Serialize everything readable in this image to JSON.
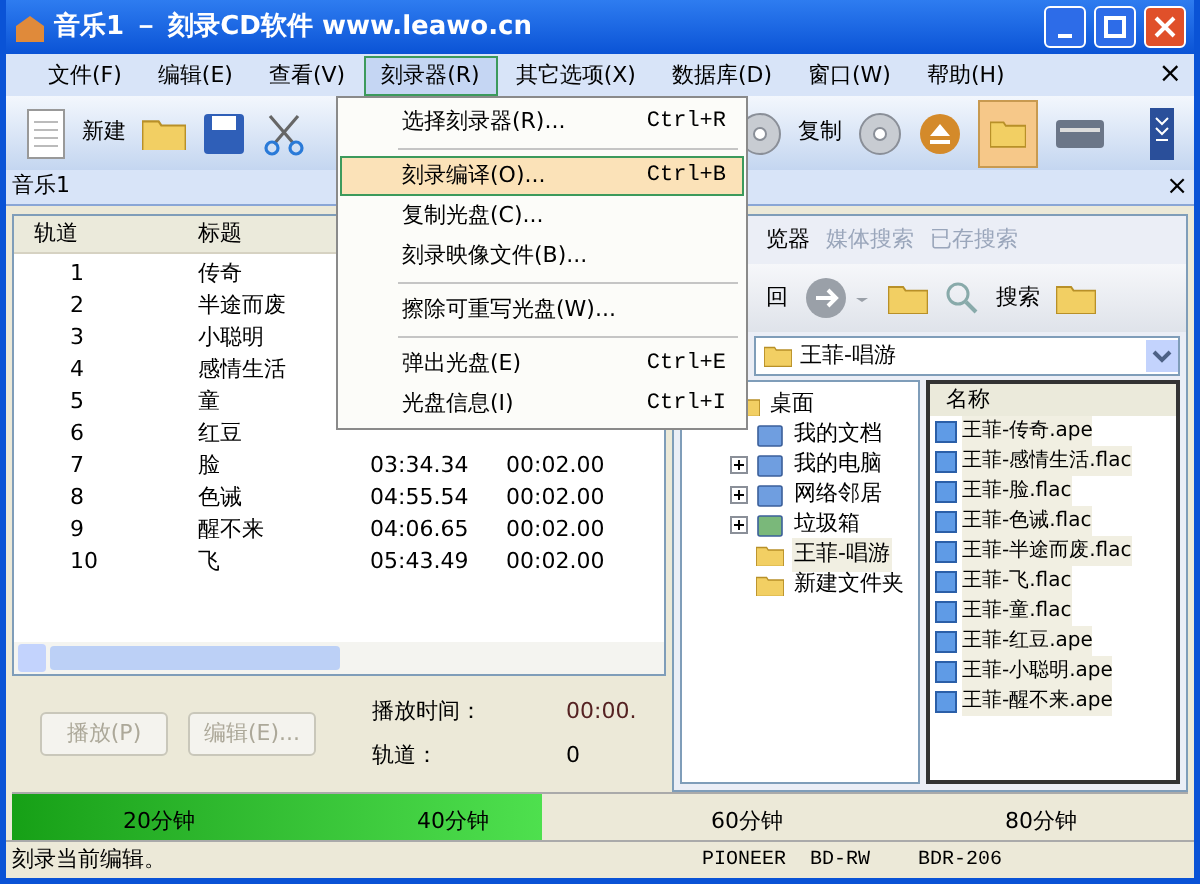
{
  "window": {
    "title": "音乐1 － 刻录CD软件 www.leawo.cn"
  },
  "menu_bar": [
    {
      "label": "文件(F)",
      "selected": false
    },
    {
      "label": "编辑(E)",
      "selected": false
    },
    {
      "label": "查看(V)",
      "selected": false
    },
    {
      "label": "刻录器(R)",
      "selected": true
    },
    {
      "label": "其它选项(X)",
      "selected": false
    },
    {
      "label": "数据库(D)",
      "selected": false
    },
    {
      "label": "窗口(W)",
      "selected": false
    },
    {
      "label": "帮助(H)",
      "selected": false
    }
  ],
  "menu_close": "×",
  "toolbar": {
    "new_label": "新建",
    "copy_label": "复制"
  },
  "dropdown": [
    {
      "kind": "item",
      "label": "选择刻录器(R)...",
      "shortcut": "Ctrl+R",
      "selected": false
    },
    {
      "kind": "separator"
    },
    {
      "kind": "item",
      "label": "刻录编译(O)...",
      "shortcut": "Ctrl+B",
      "selected": true
    },
    {
      "kind": "item",
      "label": "复制光盘(C)...",
      "selected": false
    },
    {
      "kind": "item",
      "label": "刻录映像文件(B)...",
      "selected": false
    },
    {
      "kind": "separator"
    },
    {
      "kind": "item",
      "label": "擦除可重写光盘(W)...",
      "selected": false
    },
    {
      "kind": "separator"
    },
    {
      "kind": "item",
      "label": "弹出光盘(E)",
      "shortcut": "Ctrl+E",
      "selected": false
    },
    {
      "kind": "item",
      "label": "光盘信息(I)",
      "shortcut": "Ctrl+I",
      "selected": false
    }
  ],
  "document": {
    "title": "音乐1",
    "close": "×"
  },
  "track_table": {
    "columns": [
      "轨道",
      "标题"
    ],
    "rows": [
      {
        "track": "1",
        "title": "传奇"
      },
      {
        "track": "2",
        "title": "半途而废"
      },
      {
        "track": "3",
        "title": "小聪明"
      },
      {
        "track": "4",
        "title": "感情生活"
      },
      {
        "track": "5",
        "title": "童"
      },
      {
        "track": "6",
        "title": "红豆"
      },
      {
        "track": "7",
        "title": "脸",
        "length": "03:34.34",
        "pause": "00:02.00"
      },
      {
        "track": "8",
        "title": "色诫",
        "length": "04:55.54",
        "pause": "00:02.00"
      },
      {
        "track": "9",
        "title": "醒不来",
        "length": "04:06.65",
        "pause": "00:02.00"
      },
      {
        "track": "10",
        "title": "飞",
        "length": "05:43.49",
        "pause": "00:02.00"
      }
    ]
  },
  "buttons": [
    {
      "label": "播放(P)",
      "disabled": true
    },
    {
      "label": "编辑(E)...",
      "disabled": true
    }
  ],
  "info": [
    {
      "label": "播放时间：",
      "value": "00:00."
    },
    {
      "label": "轨道：",
      "value": "0"
    }
  ],
  "browser": {
    "tabs": [
      {
        "label": "览器",
        "selected": true
      },
      {
        "label": "媒体搜索",
        "selected": false
      },
      {
        "label": "已存搜索",
        "selected": false
      }
    ],
    "back_label": "回",
    "search_label": "搜索",
    "address": "王菲-唱游",
    "tree": [
      {
        "label": "桌面",
        "children": [
          {
            "label": "我的文档"
          },
          {
            "label": "我的电脑",
            "expandable": true
          },
          {
            "label": "网络邻居",
            "expandable": true
          },
          {
            "label": "垃圾箱",
            "expandable": true
          },
          {
            "label": "王菲-唱游",
            "selected": true
          },
          {
            "label": "新建文件夹",
            "selected": false
          }
        ]
      }
    ],
    "file_column": "名称",
    "files": [
      "王菲-传奇.ape",
      "王菲-感情生活.flac",
      "王菲-脸.flac",
      "王菲-色诫.flac",
      "王菲-半途而废.flac",
      "王菲-飞.flac",
      "王菲-童.flac",
      "王菲-红豆.ape",
      "王菲-小聪明.ape",
      "王菲-醒不来.ape"
    ]
  },
  "timeline": {
    "level": 0.45,
    "labels": [
      "20分钟",
      "40分钟",
      "60分钟",
      "80分钟"
    ]
  },
  "status_bar": {
    "message": "刻录当前编辑。",
    "drive": "PIONEER  BD-RW    BDR-206"
  }
}
